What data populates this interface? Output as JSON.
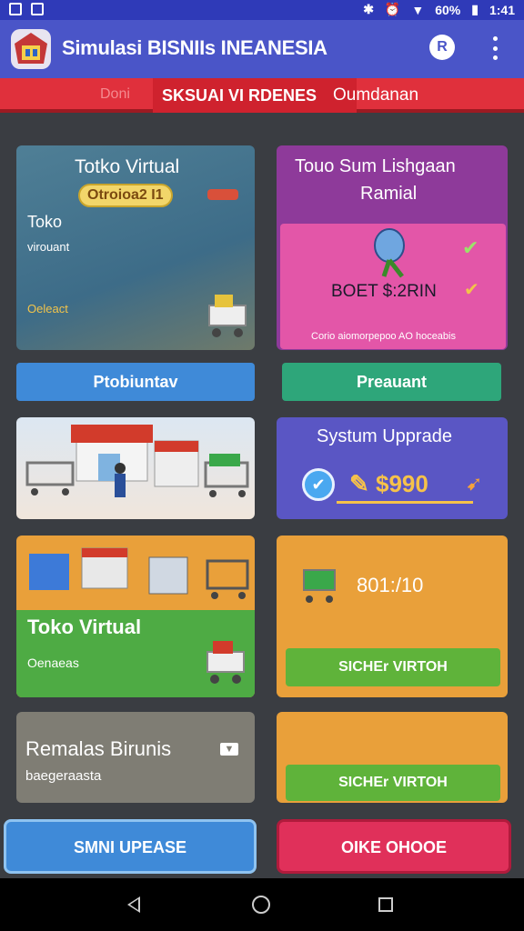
{
  "status_bar": {
    "battery": "60%",
    "time": "1:41"
  },
  "app_bar": {
    "title": "Simulasi BISNIIs INEANESIA",
    "avatar_initial": "R"
  },
  "banner": {
    "left_faded": "Doni",
    "highlight": "SKSUAI VI RDENES",
    "right": "Oumdanan"
  },
  "cards": {
    "toko_virtual": {
      "title": "Totko Virtual",
      "badge": "Otroioa2 I1",
      "label": "Toko",
      "sublabel": "virouant",
      "footer": "Oeleact"
    },
    "toko_sum": {
      "title": "Touo Sum Lishgaan",
      "subtitle": "Ramial",
      "value": "BOET $:2RIN",
      "footer": "Corio aiomorpepoo AO hoceabis"
    },
    "system_upgrade": {
      "title": "Systum Upprade",
      "price": "✎ $990"
    },
    "toko_virtual_green": {
      "title": "Toko Virtual",
      "sublabel": "Oenaeas"
    },
    "orange_stat": {
      "value": "801:/10"
    },
    "remalas": {
      "title": "Remalas Birunis",
      "sublabel": "baegeraasta"
    }
  },
  "buttons": {
    "blue1": "Ptobiuntav",
    "green1": "Preauant",
    "green2": "SICHEr VIRTOH",
    "green3": "SICHEr VIRTOH",
    "bottom_blue": "SMNI UPEASE",
    "bottom_red": "OIKE OHOOE"
  },
  "colors": {
    "app_bar": "#4a55c8",
    "banner": "#e0303c",
    "blue_button": "#3f8ad8",
    "green_button": "#2ea67a",
    "lime_button": "#5fb33a",
    "red_button": "#e0305a",
    "purple_card": "#8e3a9a",
    "pink_panel": "#e356a8",
    "orange_card": "#e9a03a",
    "upgrade_card": "#5a56c4"
  }
}
